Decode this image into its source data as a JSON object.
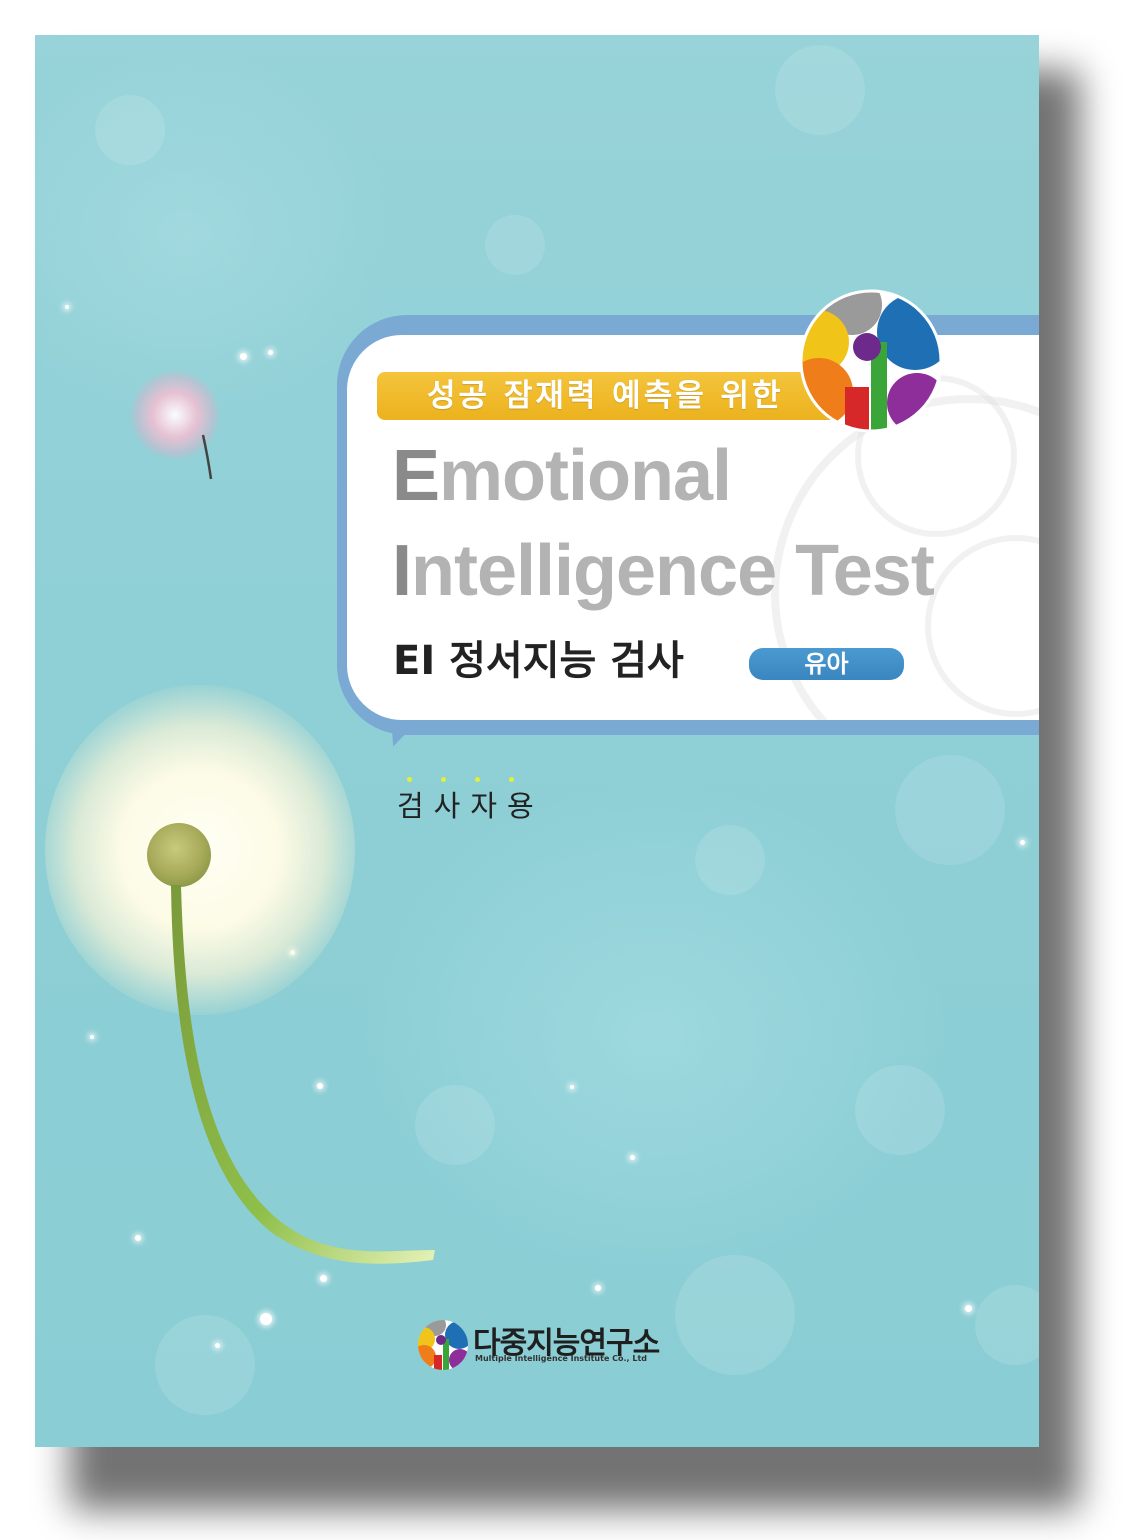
{
  "cover": {
    "subtitle": "성공 잠재력 예측을 위한",
    "title_line1_initial": "E",
    "title_line1_rest": "motional",
    "title_line2_initial": "I",
    "title_line2_rest": "ntelligence Test",
    "korean_title": "EI 정서지능 검사",
    "age_group": "유아",
    "user_label": "검사자용",
    "publisher_name_ko": "다중지능연구소",
    "publisher_name_en": "Multiple Intelligence Institute Co., Ltd"
  },
  "colors": {
    "background": "#8fd0d6",
    "panel_border": "#7aa9d4",
    "subtitle_bar": "#f0b92a",
    "age_badge": "#3d8ac4",
    "title_gray": "#b3b3b3"
  },
  "icons": {
    "logo": "multiple-intelligence-logo",
    "publisher_logo": "publisher-logo"
  }
}
